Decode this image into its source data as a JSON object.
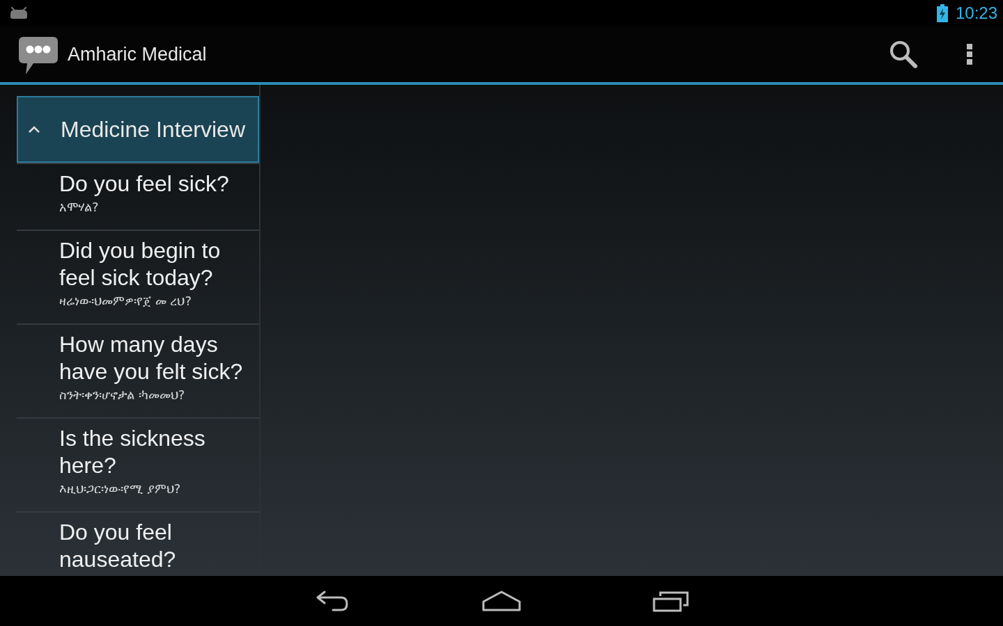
{
  "status_bar": {
    "time": "10:23"
  },
  "action_bar": {
    "title": "Amharic Medical"
  },
  "list": {
    "group": {
      "label": "Medicine Interview",
      "expanded": true,
      "selected": true
    },
    "items": [
      {
        "english": "Do you feel sick?",
        "amharic": "አሞሃል?",
        "selected": false
      },
      {
        "english": "Did you begin to feel sick today?",
        "amharic": "ዛሬነው፡ህመምዎ፡የጀ መ ረህ?",
        "selected": false
      },
      {
        "english": "How many days have you felt sick?",
        "amharic": "ስንት፡ቀን፡ሆኖታል ፡ካመመህ?",
        "selected": false
      },
      {
        "english": "Is the sickness here?",
        "amharic": "እዚህ፡ጋር፡ነው፡የሚ ያምህ?",
        "selected": false
      },
      {
        "english": "Do you feel nauseated?",
        "selected": false
      }
    ]
  }
}
